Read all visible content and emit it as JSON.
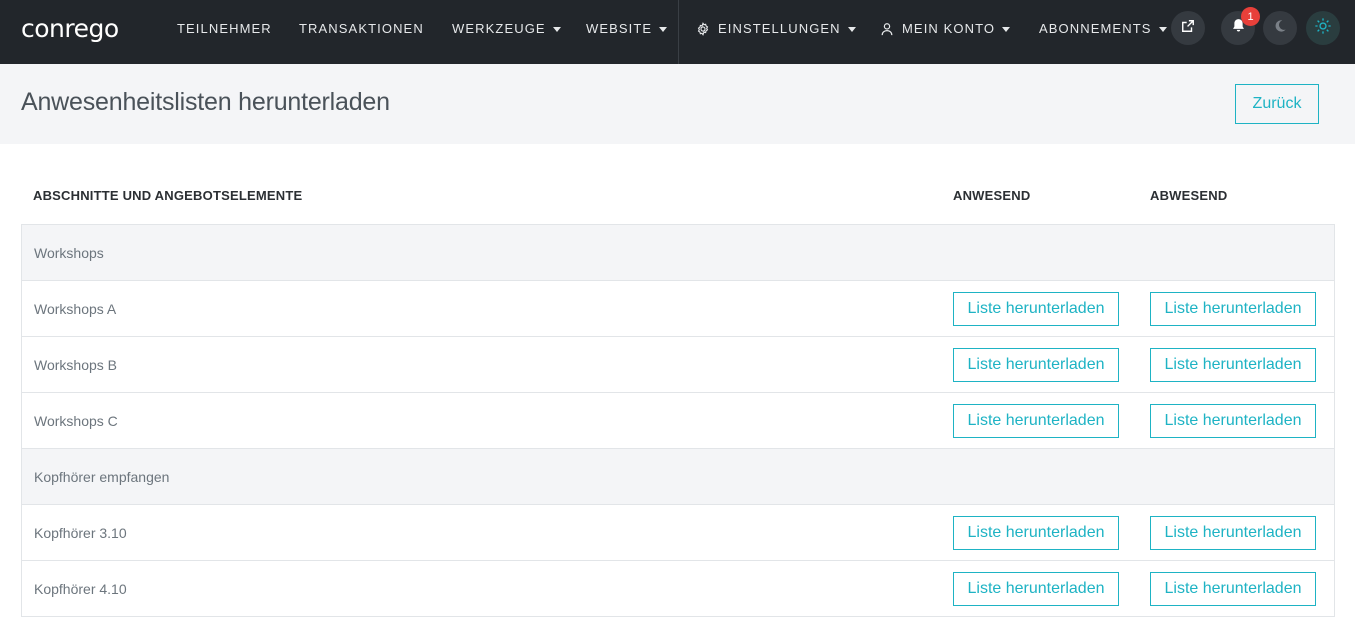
{
  "brand": {
    "logo_text": "conrego"
  },
  "nav": {
    "items": [
      {
        "label": "TEILNEHMER",
        "caret": false
      },
      {
        "label": "TRANSAKTIONEN",
        "caret": false
      },
      {
        "label": "WERKZEUGE",
        "caret": true
      },
      {
        "label": "WEBSITE",
        "caret": true
      },
      {
        "label": "EINSTELLUNGEN",
        "caret": true,
        "icon": "gear-icon"
      },
      {
        "label": "MEIN KONTO",
        "caret": true,
        "icon": "user-icon"
      },
      {
        "label": "ABONNEMENTS",
        "caret": true
      }
    ],
    "notification_count": "1",
    "icons": [
      "external-link-icon",
      "bell-icon",
      "moon-icon",
      "sun-icon"
    ]
  },
  "header": {
    "title": "Anwesenheitslisten herunterladen",
    "back_label": "Zurück"
  },
  "table": {
    "columns": [
      "ABSCHNITTE UND ANGEBOTSELEMENTE",
      "ANWESEND",
      "ABWESEND"
    ],
    "download_label": "Liste herunterladen",
    "rows": [
      {
        "label": "Workshops",
        "group": true
      },
      {
        "label": "Workshops A",
        "group": false
      },
      {
        "label": "Workshops B",
        "group": false
      },
      {
        "label": "Workshops C",
        "group": false
      },
      {
        "label": "Kopfhörer empfangen",
        "group": true
      },
      {
        "label": "Kopfhörer 3.10",
        "group": false
      },
      {
        "label": "Kopfhörer 4.10",
        "group": false
      }
    ]
  },
  "colors": {
    "navbar": "#22262b",
    "accent": "#1eb3c4",
    "badge": "#e8403a",
    "header_bg": "#f4f5f7"
  }
}
